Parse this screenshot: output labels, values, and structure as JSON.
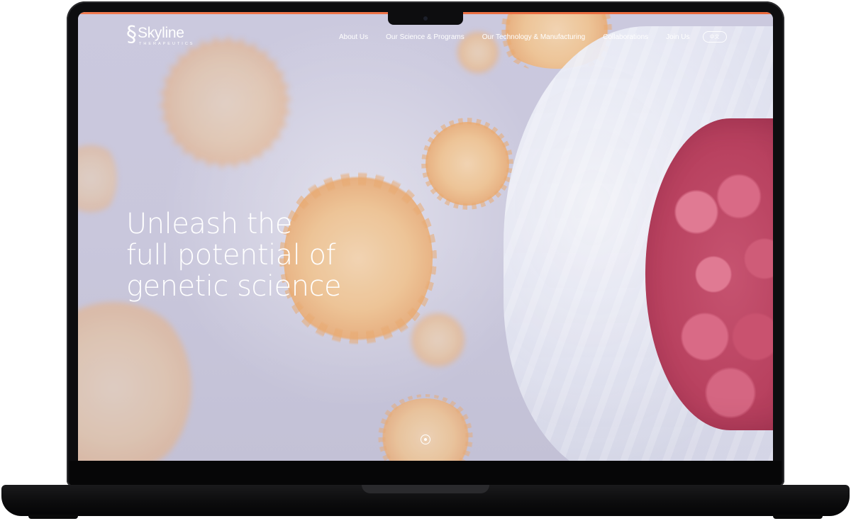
{
  "device": "laptop",
  "brand": {
    "name": "Skyline",
    "subtitle": "THERAPEUTICS"
  },
  "nav": {
    "items": [
      {
        "label": "About Us"
      },
      {
        "label": "Our Science & Programs"
      },
      {
        "label": "Our Technology & Manufacturing"
      },
      {
        "label": "Collaborations"
      },
      {
        "label": "Join Us"
      }
    ],
    "language_toggle": "中文"
  },
  "hero": {
    "title_lines": [
      "Unleash the",
      "full potential of",
      "genetic science"
    ]
  },
  "slider": {
    "dot_count": 1,
    "active_index": 0
  },
  "colors": {
    "accent_bar": "#e9683a",
    "text": "#ffffff",
    "background": "#cbc9de",
    "virus": "#efc494",
    "tumor": "#c65370"
  },
  "icons": {
    "logo": "skyline-helix-logo",
    "slider_indicator": "slider-dot-icon"
  }
}
